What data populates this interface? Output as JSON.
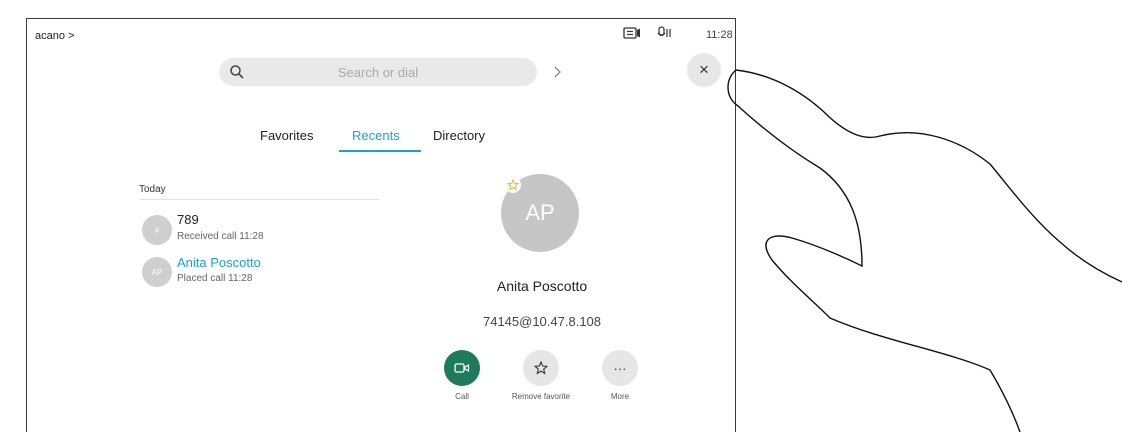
{
  "header": {
    "breadcrumb": "acano >",
    "time": "11:28"
  },
  "search": {
    "placeholder": "Search or dial",
    "arrow": ">"
  },
  "close_symbol": "×",
  "tabs": [
    {
      "label": "Favorites",
      "active": false
    },
    {
      "label": "Recents",
      "active": true
    },
    {
      "label": "Directory",
      "active": false
    }
  ],
  "recents": {
    "section": "Today",
    "items": [
      {
        "avatar": "#",
        "title": "789",
        "subtitle": "Received call 11:28"
      },
      {
        "avatar": "AP",
        "title": "Anita Poscotto",
        "subtitle": "Placed call 11:28",
        "highlighted": true
      }
    ]
  },
  "contact": {
    "initials": "AP",
    "name": "Anita Poscotto",
    "address": "74145@10.47.8.108",
    "favorite": true
  },
  "actions": [
    {
      "label": "Call",
      "icon": "video-camera-icon"
    },
    {
      "label": "Remove favorite",
      "icon": "star-icon"
    },
    {
      "label": "More",
      "icon": "ellipsis-icon",
      "symbol": "···"
    }
  ],
  "colors": {
    "accent": "#1ba2cc",
    "call_button": "#1d7a5a",
    "favorite_star": "#f0b429",
    "avatar_grey": "#c6c6c6"
  }
}
